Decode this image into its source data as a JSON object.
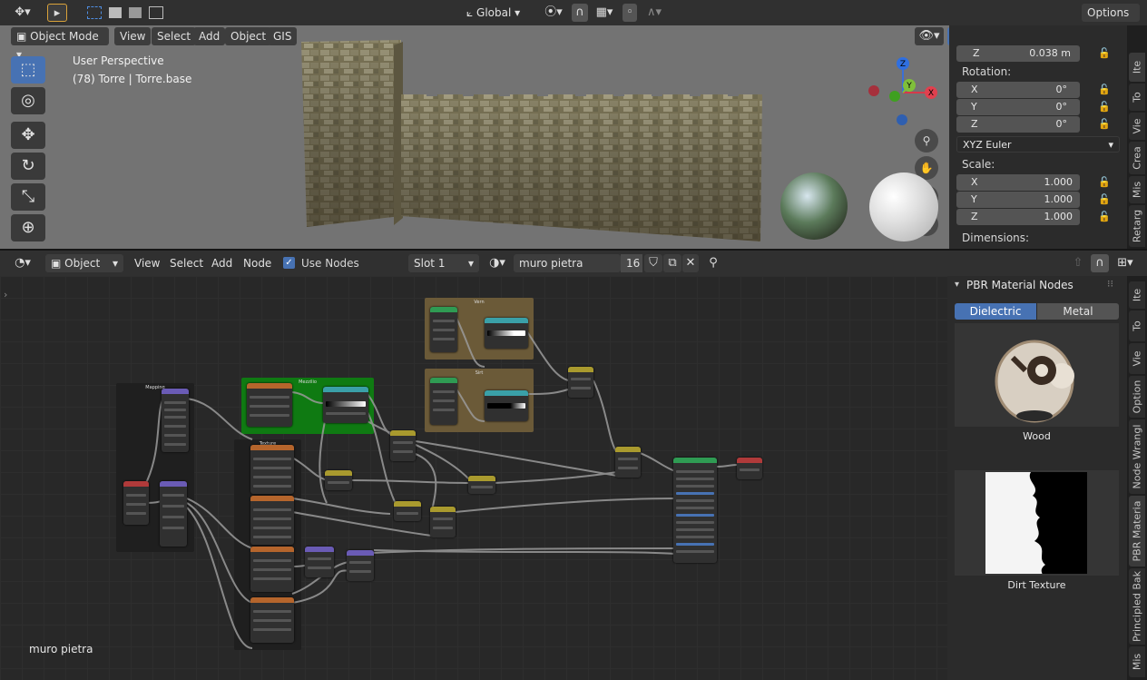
{
  "top_header": {
    "transform_orientation": "Global",
    "options_label": "Options"
  },
  "viewport_header": {
    "mode": "Object Mode",
    "menus": [
      "View",
      "Select",
      "Add",
      "Object",
      "GIS"
    ]
  },
  "viewport": {
    "overlay_line1": "User Perspective",
    "overlay_line2": "(78) Torre | Torre.base",
    "gizmo_axes": [
      "Z",
      "Y",
      "X"
    ]
  },
  "npanel": {
    "location_z_label": "Z",
    "location_z_value": "0.038 m",
    "rotation_label": "Rotation:",
    "rotation": [
      {
        "axis": "X",
        "value": "0°"
      },
      {
        "axis": "Y",
        "value": "0°"
      },
      {
        "axis": "Z",
        "value": "0°"
      }
    ],
    "rotation_mode": "XYZ Euler",
    "scale_label": "Scale:",
    "scale": [
      {
        "axis": "X",
        "value": "1.000"
      },
      {
        "axis": "Y",
        "value": "1.000"
      },
      {
        "axis": "Z",
        "value": "1.000"
      }
    ],
    "dimensions_label": "Dimensions:",
    "tabs": [
      "Ite",
      "To",
      "Vie",
      "Crea",
      "Mis",
      "Retarg"
    ]
  },
  "node_header": {
    "type_label": "Object",
    "menus": [
      "View",
      "Select",
      "Add",
      "Node"
    ],
    "use_nodes_label": "Use Nodes",
    "use_nodes_checked": true,
    "slot": "Slot 1",
    "material_name": "muro pietra",
    "user_count": "16"
  },
  "node_canvas": {
    "material_label": "muro pietra",
    "frame_labels": [
      "Mapping",
      "Mezzilio",
      "Texture",
      "Vern",
      "Sirt"
    ]
  },
  "pbr_panel": {
    "title": "PBR Material Nodes",
    "tab_dielectric": "Dielectric",
    "tab_metal": "Metal",
    "active_tab": "Dielectric",
    "preview1_label": "Wood",
    "preview2_label": "Dirt Texture",
    "tabs": [
      "Ite",
      "To",
      "Vie",
      "Option",
      "Node Wrangl",
      "PBR Materia",
      "Principled Bak",
      "Mis"
    ]
  },
  "colors": {
    "accent_blue": "#4772b3",
    "frame_green": "#0f7a12",
    "frame_brown": "#6b5a38",
    "node_header_orange": "#b5652c",
    "node_header_purple": "#6a5bb5",
    "node_header_teal": "#3aa0a8",
    "node_header_yellow": "#a99a2e",
    "node_header_red": "#b03a3a",
    "node_header_green": "#2f9b53"
  }
}
